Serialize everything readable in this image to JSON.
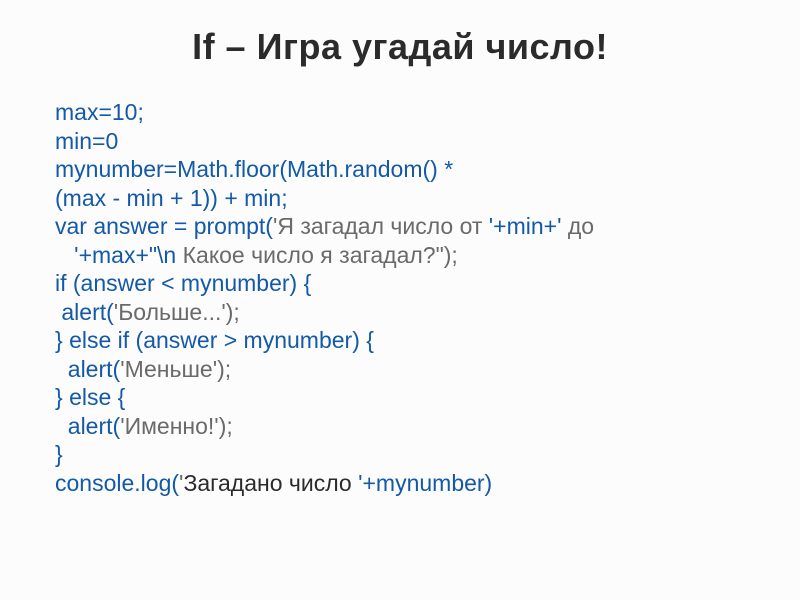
{
  "title": "If – Игра угадай число!",
  "code": {
    "l1a": "max=10;",
    "l2a": "min=0",
    "l3a": "mynumber=Math.floor(Math.random() *",
    "l4a": "(max - min + 1)) + min;",
    "l5a": "var answer = prompt(",
    "l5b": "'Я загадал число от ",
    "l5c": "'+min+'",
    "l5d": " до",
    "l6a": "   '+max+\"\\n",
    "l6b": " Какое число я загадал?\");",
    "l7a": "if (answer < mynumber) {",
    "l8a": " alert(",
    "l8b": "'Больше...');",
    "l9a": "} else if (answer > mynumber) {",
    "l10a": "  alert(",
    "l10b": "'Меньше');",
    "l11a": "} else {",
    "l12a": "  alert(",
    "l12b": "'Именно!');",
    "l13a": "}",
    "l14a": "console.log(",
    "l14b": "'",
    "l14c": "Загадано число ",
    "l14d": "'+mynumber)"
  }
}
